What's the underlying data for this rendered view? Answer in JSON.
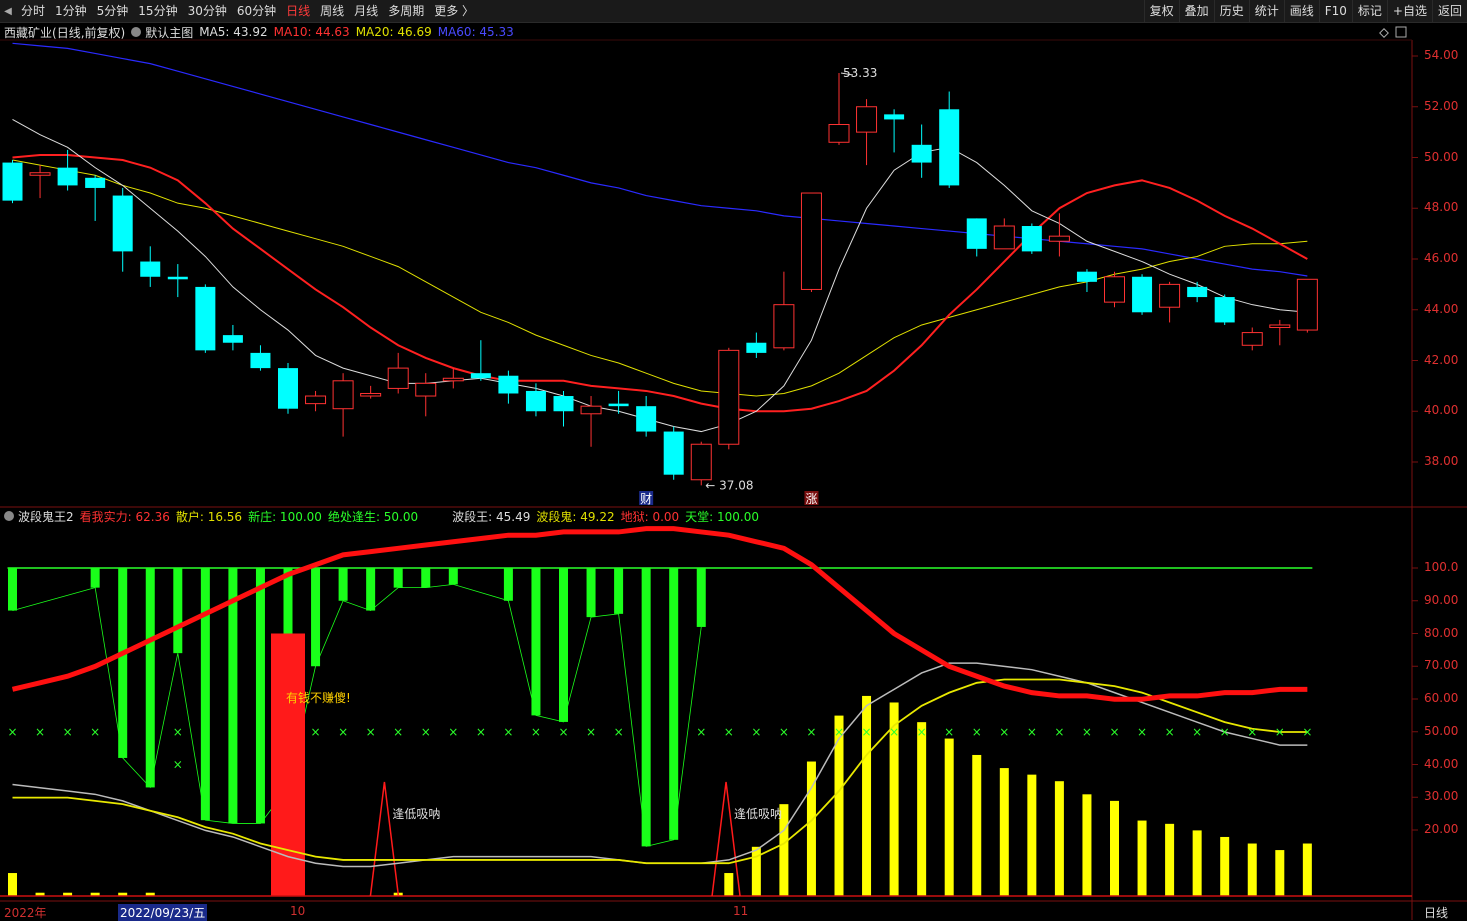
{
  "toolbar": {
    "left": [
      "分时",
      "1分钟",
      "5分钟",
      "15分钟",
      "30分钟",
      "60分钟",
      "日线",
      "周线",
      "月线",
      "多周期",
      "更多 〉"
    ],
    "active": "日线",
    "right": [
      "复权",
      "叠加",
      "历史",
      "统计",
      "画线",
      "F10",
      "标记",
      "+自选",
      "返回"
    ]
  },
  "main_legend": {
    "stock": "西藏矿业",
    "period": "(日线,前复权)",
    "template": "默认主图",
    "ma5": "MA5: 43.92",
    "ma10": "MA10: 44.63",
    "ma20": "MA20: 46.69",
    "ma60": "MA60: 45.33"
  },
  "sub_legend": {
    "name": "波段鬼王2",
    "kanwo": "看我实力: 62.36",
    "sanhu": "散户: 16.56",
    "xinzhuang": "新庄: 100.00",
    "juechu": "绝处逢生: 50.00",
    "boduanwang": "波段王: 45.49",
    "boduangui": "波段鬼: 49.22",
    "diyu": "地狱: 0.00",
    "tiantang": "天堂: 100.00"
  },
  "annotations": {
    "high": "53.33",
    "low": "37.08",
    "cai": "财",
    "zhang": "涨",
    "youqian": "有钱不赚傻!",
    "fengdi1": "逢低吸呐",
    "fengdi2": "逢低吸呐"
  },
  "dates": {
    "year": "2022年",
    "cursor": "2022/09/23/五",
    "m10": "10",
    "m11": "11",
    "period": "日线"
  },
  "price_axis": [
    "54.00",
    "52.00",
    "50.00",
    "48.00",
    "46.00",
    "44.00",
    "42.00",
    "40.00",
    "38.00"
  ],
  "osc_axis": [
    "100.0",
    "90.00",
    "80.00",
    "70.00",
    "60.00",
    "50.00",
    "40.00",
    "30.00",
    "20.00"
  ],
  "colors": {
    "up": "#ff3232",
    "down": "#00ffff",
    "ma5": "#dddddd",
    "ma10": "#ff2020",
    "ma20": "#e0e000",
    "ma60": "#2a2aff"
  },
  "chart_data": [
    {
      "type": "candlestick",
      "title": "西藏矿业 (日线,前复权)",
      "ylim": [
        36.5,
        55.5
      ],
      "candles": [
        [
          49.8,
          48.3,
          49.9,
          48.2
        ],
        [
          49.3,
          49.4,
          49.7,
          48.4
        ],
        [
          49.6,
          48.9,
          50.3,
          48.7
        ],
        [
          49.2,
          48.8,
          49.3,
          47.5
        ],
        [
          48.5,
          46.3,
          48.8,
          45.5
        ],
        [
          45.9,
          45.3,
          46.5,
          44.9
        ],
        [
          45.3,
          45.2,
          45.8,
          44.5
        ],
        [
          44.9,
          42.4,
          45.0,
          42.3
        ],
        [
          43.0,
          42.7,
          43.4,
          42.4
        ],
        [
          42.3,
          41.7,
          42.6,
          41.6
        ],
        [
          41.7,
          40.1,
          41.9,
          39.9
        ],
        [
          40.3,
          40.6,
          40.8,
          40.0
        ],
        [
          40.1,
          41.2,
          41.5,
          39.0
        ],
        [
          40.6,
          40.7,
          41.0,
          40.5
        ],
        [
          40.9,
          41.7,
          42.3,
          40.7
        ],
        [
          40.6,
          41.1,
          41.5,
          39.8
        ],
        [
          41.2,
          41.3,
          41.7,
          40.9
        ],
        [
          41.5,
          41.3,
          42.8,
          41.2
        ],
        [
          41.4,
          40.7,
          41.6,
          40.3
        ],
        [
          40.8,
          40.0,
          41.1,
          39.8
        ],
        [
          40.6,
          40.0,
          40.8,
          39.4
        ],
        [
          39.9,
          40.2,
          40.6,
          38.6
        ],
        [
          40.3,
          40.2,
          40.8,
          39.9
        ],
        [
          40.2,
          39.2,
          40.6,
          39.0
        ],
        [
          39.2,
          37.5,
          39.4,
          37.3
        ],
        [
          37.3,
          38.7,
          38.8,
          37.08
        ],
        [
          38.7,
          42.4,
          42.5,
          38.5
        ],
        [
          42.7,
          42.3,
          43.1,
          42.1
        ],
        [
          42.5,
          44.2,
          45.5,
          42.4
        ],
        [
          44.8,
          48.6,
          48.6,
          44.7
        ],
        [
          50.6,
          51.3,
          53.33,
          50.5
        ],
        [
          51.0,
          52.0,
          52.3,
          49.7
        ],
        [
          51.7,
          51.5,
          51.9,
          50.2
        ],
        [
          50.5,
          49.8,
          51.3,
          49.2
        ],
        [
          51.9,
          48.9,
          52.6,
          48.8
        ],
        [
          47.6,
          46.4,
          47.6,
          46.1
        ],
        [
          46.4,
          47.3,
          47.6,
          46.4
        ],
        [
          47.3,
          46.3,
          47.4,
          46.2
        ],
        [
          46.7,
          46.9,
          47.8,
          46.1
        ],
        [
          45.5,
          45.1,
          45.6,
          44.7
        ],
        [
          44.3,
          45.3,
          45.5,
          44.1
        ],
        [
          45.3,
          43.9,
          45.4,
          43.8
        ],
        [
          44.1,
          45.0,
          45.1,
          43.5
        ],
        [
          44.9,
          44.5,
          45.1,
          44.3
        ],
        [
          44.5,
          43.5,
          44.6,
          43.4
        ],
        [
          42.6,
          43.1,
          43.3,
          42.4
        ],
        [
          43.3,
          43.4,
          43.6,
          42.6
        ],
        [
          43.2,
          45.2,
          45.2,
          43.1
        ]
      ],
      "ma5": [
        51.5,
        50.9,
        50.4,
        49.6,
        48.9,
        48.0,
        47.1,
        46.1,
        44.9,
        44.0,
        43.2,
        42.2,
        41.7,
        41.4,
        41.1,
        41.1,
        41.2,
        41.3,
        41.1,
        40.9,
        40.6,
        40.2,
        40.0,
        39.7,
        39.4,
        39.2,
        39.5,
        40.0,
        41.0,
        42.8,
        45.6,
        48.0,
        49.5,
        50.2,
        50.4,
        49.8,
        48.9,
        47.9,
        47.4,
        46.7,
        46.3,
        45.9,
        45.4,
        45.0,
        44.5,
        44.2,
        44.0,
        43.9
      ],
      "ma10": [
        50.0,
        50.1,
        50.1,
        50.0,
        49.9,
        49.6,
        49.1,
        48.2,
        47.2,
        46.4,
        45.6,
        44.8,
        44.1,
        43.3,
        42.6,
        42.1,
        41.7,
        41.4,
        41.2,
        41.2,
        41.2,
        41.0,
        40.9,
        40.8,
        40.6,
        40.3,
        40.1,
        40.0,
        40.0,
        40.1,
        40.4,
        40.8,
        41.6,
        42.6,
        43.8,
        44.8,
        45.9,
        47.0,
        48.0,
        48.6,
        48.9,
        49.1,
        48.8,
        48.3,
        47.7,
        47.2,
        46.6,
        46.0
      ],
      "ma20": [
        49.9,
        49.7,
        49.5,
        49.3,
        48.9,
        48.6,
        48.2,
        48.0,
        47.7,
        47.4,
        47.1,
        46.8,
        46.5,
        46.1,
        45.7,
        45.1,
        44.5,
        43.9,
        43.5,
        43.0,
        42.6,
        42.2,
        41.9,
        41.5,
        41.1,
        40.8,
        40.7,
        40.6,
        40.7,
        41.0,
        41.5,
        42.2,
        42.9,
        43.4,
        43.7,
        44.0,
        44.3,
        44.6,
        44.9,
        45.1,
        45.4,
        45.6,
        45.9,
        46.1,
        46.5,
        46.6,
        46.6,
        46.7
      ],
      "ma60": [
        54.5,
        54.4,
        54.3,
        54.1,
        53.9,
        53.7,
        53.4,
        53.1,
        52.8,
        52.5,
        52.2,
        51.9,
        51.6,
        51.3,
        51.0,
        50.7,
        50.4,
        50.1,
        49.8,
        49.6,
        49.3,
        49.0,
        48.8,
        48.5,
        48.3,
        48.1,
        48.0,
        47.9,
        47.7,
        47.6,
        47.5,
        47.4,
        47.3,
        47.2,
        47.1,
        47.0,
        46.9,
        46.8,
        46.7,
        46.6,
        46.5,
        46.4,
        46.2,
        46.0,
        45.8,
        45.6,
        45.5,
        45.33
      ]
    },
    {
      "type": "bar",
      "title": "波段鬼王2",
      "ylim": [
        0,
        110
      ],
      "green_bars": [
        87,
        null,
        null,
        94,
        42,
        33,
        74,
        23,
        22,
        22,
        33,
        70,
        90,
        87,
        94,
        94,
        95,
        null,
        90,
        55,
        53,
        85,
        86,
        15,
        17,
        82,
        null,
        null,
        null,
        null,
        null,
        null,
        null,
        null,
        null,
        null,
        null,
        null,
        null,
        null,
        null,
        null,
        null,
        null,
        null,
        null,
        null,
        null
      ],
      "red_bars": [
        null,
        null,
        null,
        null,
        null,
        null,
        null,
        null,
        null,
        null,
        80,
        null,
        null,
        null,
        null,
        null,
        null,
        null,
        null,
        null,
        null,
        null,
        null,
        null,
        null,
        null,
        null,
        null,
        null,
        null,
        null,
        null,
        null,
        null,
        null,
        null,
        null,
        null,
        null,
        null,
        null,
        null,
        null,
        null,
        null,
        null,
        null,
        null
      ],
      "yellow_bars": [
        7,
        1,
        1,
        1,
        1,
        1,
        null,
        null,
        null,
        null,
        null,
        null,
        null,
        null,
        1,
        null,
        null,
        null,
        null,
        null,
        null,
        null,
        null,
        null,
        null,
        null,
        7,
        15,
        28,
        41,
        55,
        61,
        59,
        53,
        48,
        43,
        39,
        37,
        35,
        31,
        29,
        23,
        22,
        20,
        18,
        16,
        14,
        16
      ],
      "red_line": [
        63,
        65,
        67,
        70,
        74,
        78,
        82,
        86,
        90,
        94,
        98,
        101,
        104,
        105,
        106,
        107,
        108,
        109,
        110,
        110,
        111,
        111,
        111,
        112,
        112,
        111,
        110,
        108,
        106,
        101,
        94,
        87,
        80,
        75,
        70,
        67,
        64,
        62,
        61,
        61,
        60,
        60,
        61,
        61,
        62,
        62,
        63,
        63
      ],
      "white_line": [
        34,
        33,
        32,
        31,
        29,
        26,
        23,
        20,
        18,
        15,
        12,
        10,
        9,
        9,
        10,
        11,
        12,
        12,
        12,
        12,
        12,
        12,
        11,
        10,
        10,
        10,
        11,
        14,
        20,
        33,
        48,
        58,
        63,
        68,
        71,
        71,
        70,
        69,
        67,
        65,
        62,
        59,
        56,
        53,
        50,
        48,
        46,
        46
      ],
      "yellow_line": [
        30,
        30,
        30,
        29,
        28,
        26,
        24,
        21,
        19,
        16,
        14,
        12,
        11,
        11,
        11,
        11,
        11,
        11,
        11,
        11,
        11,
        11,
        11,
        10,
        10,
        10,
        10,
        12,
        16,
        23,
        32,
        43,
        52,
        58,
        62,
        65,
        66,
        66,
        66,
        65,
        64,
        62,
        59,
        56,
        53,
        51,
        50,
        50
      ],
      "marker_50": true
    }
  ]
}
